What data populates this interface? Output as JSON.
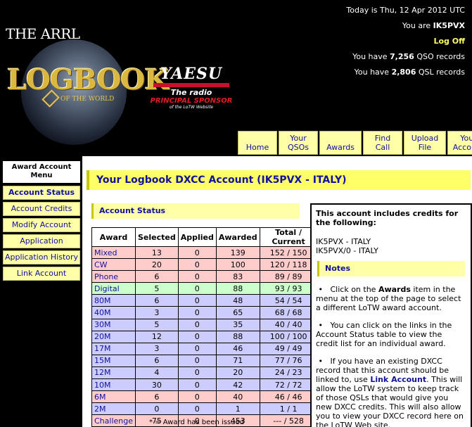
{
  "header": {
    "logo_top": "THE ARRL",
    "logo_main": "LOGBOOK",
    "logo_sub": "OF THE WORLD",
    "sponsor_brand": "YAESU",
    "sponsor_radio": "The radio",
    "sponsor_principal": "PRINCIPAL SPONSOR",
    "sponsor_of": "of the LoTW Website"
  },
  "userinfo": {
    "date_line": "Today is Thu, 12 Apr 2012 UTC",
    "you_are_prefix": "You are ",
    "callsign": "IK5PVX",
    "logoff": "Log Off",
    "qso_prefix": "You have ",
    "qso_count": "7,256",
    "qso_suffix": " QSO records",
    "qsl_prefix": "You have ",
    "qsl_count": "2,806",
    "qsl_suffix": " QSL records"
  },
  "topnav": [
    {
      "line1": "",
      "line2": "Home"
    },
    {
      "line1": "Your",
      "line2": "QSOs"
    },
    {
      "line1": "",
      "line2": "Awards"
    },
    {
      "line1": "Find",
      "line2": "Call"
    },
    {
      "line1": "Upload",
      "line2": "File"
    },
    {
      "line1": "Your",
      "line2": "Account"
    }
  ],
  "menu": {
    "title_line1": "Award Account",
    "title_line2": "Menu",
    "items": [
      "Account Status",
      "Account Credits",
      "Modify Account",
      "Application",
      "Application History",
      "Link Account"
    ]
  },
  "page_title": "Your Logbook DXCC Account (IK5PVX - ITALY)",
  "status_heading": "Account Status",
  "table": {
    "headers": [
      "Award",
      "Selected",
      "Applied",
      "Awarded",
      "Total / Current"
    ],
    "rows": [
      [
        "Mixed",
        "13",
        "0",
        "139",
        "152 / 150"
      ],
      [
        "CW",
        "20",
        "0",
        "100",
        "120 / 118"
      ],
      [
        "Phone",
        "6",
        "0",
        "83",
        "89 / 89"
      ],
      [
        "Digital",
        "5",
        "0",
        "88",
        "93 / 93"
      ],
      [
        "80M",
        "6",
        "0",
        "48",
        "54 / 54"
      ],
      [
        "40M",
        "3",
        "0",
        "65",
        "68 / 68"
      ],
      [
        "30M",
        "5",
        "0",
        "35",
        "40 / 40"
      ],
      [
        "20M",
        "12",
        "0",
        "88",
        "100 / 100"
      ],
      [
        "17M",
        "3",
        "0",
        "46",
        "49 / 49"
      ],
      [
        "15M",
        "6",
        "0",
        "71",
        "77 / 76"
      ],
      [
        "12M",
        "4",
        "0",
        "20",
        "24 / 23"
      ],
      [
        "10M",
        "30",
        "0",
        "42",
        "72 / 72"
      ],
      [
        "6M",
        "6",
        "0",
        "40",
        "46 / 46"
      ],
      [
        "2M",
        "0",
        "0",
        "1",
        "1 / 1"
      ],
      [
        "Challenge",
        "75",
        "0",
        "453",
        "--- / 528"
      ]
    ]
  },
  "footnote": "* = Award has been issued",
  "infobox": {
    "intro": "This account includes credits for the following:",
    "call1": "IK5PVX - ITALY",
    "call2": "IK5PVX/0 - ITALY",
    "notes_heading": "Notes",
    "note1_pre": "Click on the ",
    "note1_bold": "Awards",
    "note1_post": " item in the menu at the top of the page to select a different LoTW award account.",
    "note2": "You can click on the links in the Account Status table to view the credit list for an individual award.",
    "note3_pre": "If you have an existing DXCC record that this account should be linked to, use ",
    "note3_link": "Link Account",
    "note3_post": ". This will allow the LoTW system to keep track of those QSLs that would give you new DXCC credits. This will also allow you to view your DXCC record here on the LoTW Web site."
  },
  "colors": {
    "nav_bg": "#ffffa8",
    "title_bg": "#ffff66",
    "link": "#10129c",
    "row_pink": "#ffcccc",
    "row_green": "#ccffcc",
    "row_blue": "#ccccff"
  }
}
